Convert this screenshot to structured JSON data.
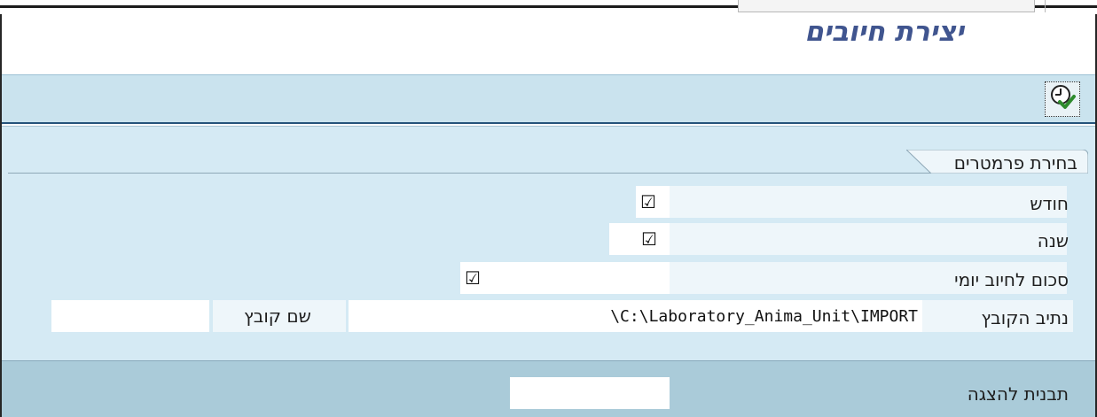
{
  "header": {
    "title": "יצירת חיובים"
  },
  "toolbar": {
    "execute_icon": "execute-clock-check-icon"
  },
  "group": {
    "label": "בחירת פרמטרים"
  },
  "fields": {
    "month": {
      "label": "חודש",
      "checked": true
    },
    "year": {
      "label": "שנה",
      "checked": true
    },
    "daily_amount": {
      "label": "סכום לחיוב יומי",
      "checked": true
    },
    "file_path": {
      "label": "נתיב הקובץ",
      "value": "\\C:\\Laboratory_Anima_Unit\\IMPORT"
    },
    "file_name": {
      "label": "שם קובץ",
      "value": ""
    },
    "display_template": {
      "label": "תבנית להצגה",
      "value": ""
    }
  },
  "colors": {
    "title": "#40558f",
    "toolbar_bg": "#cae3ee",
    "content_bg": "#d5eaf4",
    "bottom_bg": "#aacbd9",
    "toolbar_border": "#25537a"
  }
}
